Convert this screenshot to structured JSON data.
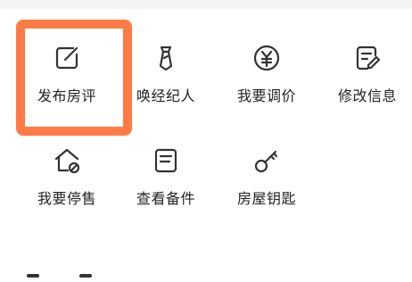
{
  "actions": {
    "row1": [
      {
        "label": "发布房评",
        "icon": "edit-square-icon"
      },
      {
        "label": "唤经纪人",
        "icon": "agent-tie-icon"
      },
      {
        "label": "我要调价",
        "icon": "yuan-price-icon"
      },
      {
        "label": "修改信息",
        "icon": "edit-document-icon"
      }
    ],
    "row2": [
      {
        "label": "我要停售",
        "icon": "house-stop-icon"
      },
      {
        "label": "查看备件",
        "icon": "document-list-icon"
      },
      {
        "label": "房屋钥匙",
        "icon": "key-icon"
      }
    ]
  },
  "highlight": {
    "color": "#ff7a45",
    "target": "发布房评"
  }
}
